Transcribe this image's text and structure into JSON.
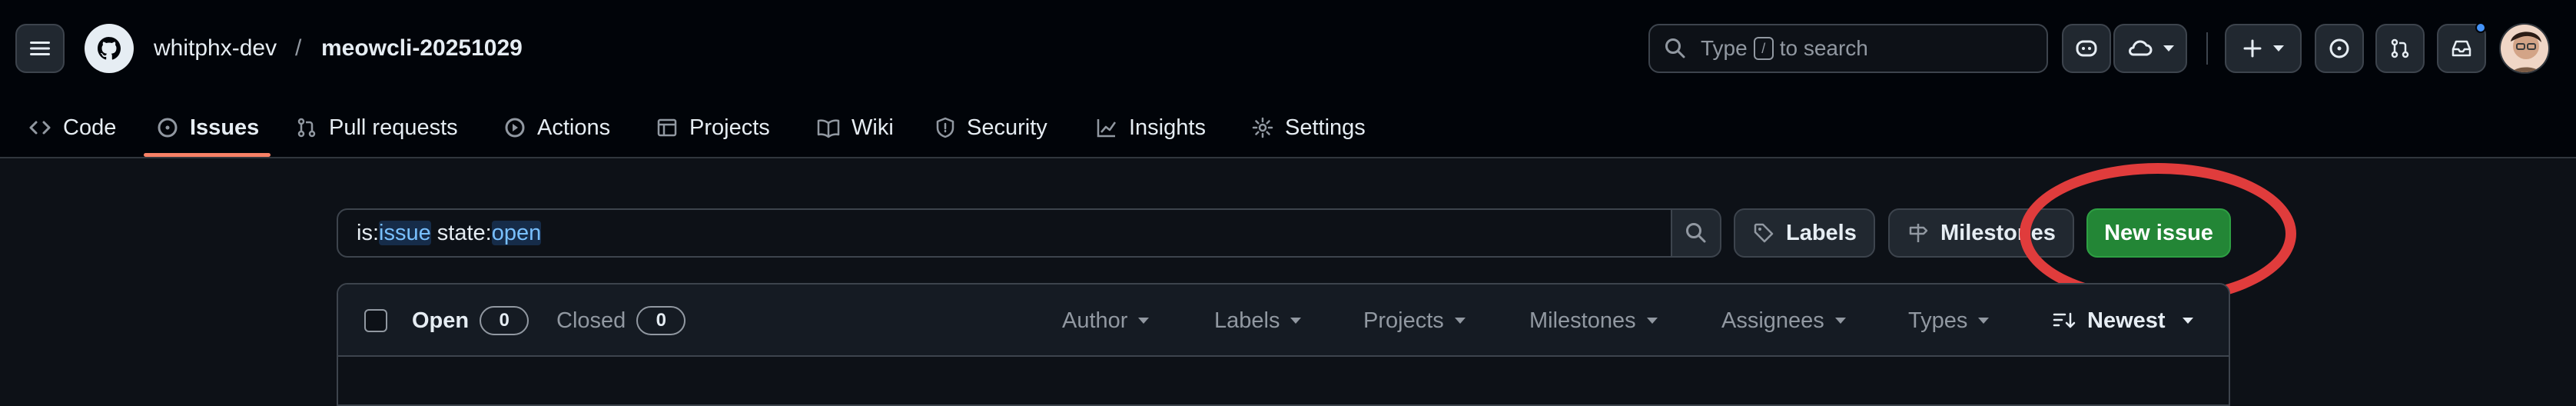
{
  "header": {
    "repo_owner": "whitphx-dev",
    "repo_separator": "/",
    "repo_name": "meowcli-20251029",
    "search": {
      "text_before_key": "Type",
      "key": "/",
      "text_after_key": "to search"
    },
    "icons": [
      "hamburger-menu-icon",
      "github-logo-icon",
      "search-icon",
      "copilot-icon",
      "cloud-icon",
      "plus-icon",
      "issues-icon",
      "pull-request-icon",
      "inbox-icon",
      "avatar"
    ]
  },
  "nav": {
    "tabs": [
      {
        "label": "Code",
        "icon": "code-icon",
        "active": false
      },
      {
        "label": "Issues",
        "icon": "issue-opened-icon",
        "active": true
      },
      {
        "label": "Pull requests",
        "icon": "git-pull-request-icon",
        "active": false
      },
      {
        "label": "Actions",
        "icon": "play-icon",
        "active": false
      },
      {
        "label": "Projects",
        "icon": "table-icon",
        "active": false
      },
      {
        "label": "Wiki",
        "icon": "book-icon",
        "active": false
      },
      {
        "label": "Security",
        "icon": "shield-icon",
        "active": false
      },
      {
        "label": "Insights",
        "icon": "graph-icon",
        "active": false
      },
      {
        "label": "Settings",
        "icon": "gear-icon",
        "active": false
      }
    ],
    "active_color": "#f78166"
  },
  "issues_toolbar": {
    "filter": {
      "prefix_1": "is:",
      "value_1": "issue",
      "prefix_2": " state:",
      "value_2": "open"
    },
    "labels_button": "Labels",
    "milestones_button": "Milestones",
    "new_issue_button": "New issue",
    "accent_green": "#238636",
    "annotation_color": "#e03c3c"
  },
  "issue_list": {
    "open_label": "Open",
    "open_count": "0",
    "closed_label": "Closed",
    "closed_count": "0",
    "filters": [
      "Author",
      "Labels",
      "Projects",
      "Milestones",
      "Assignees",
      "Types"
    ],
    "sort": "Newest"
  }
}
